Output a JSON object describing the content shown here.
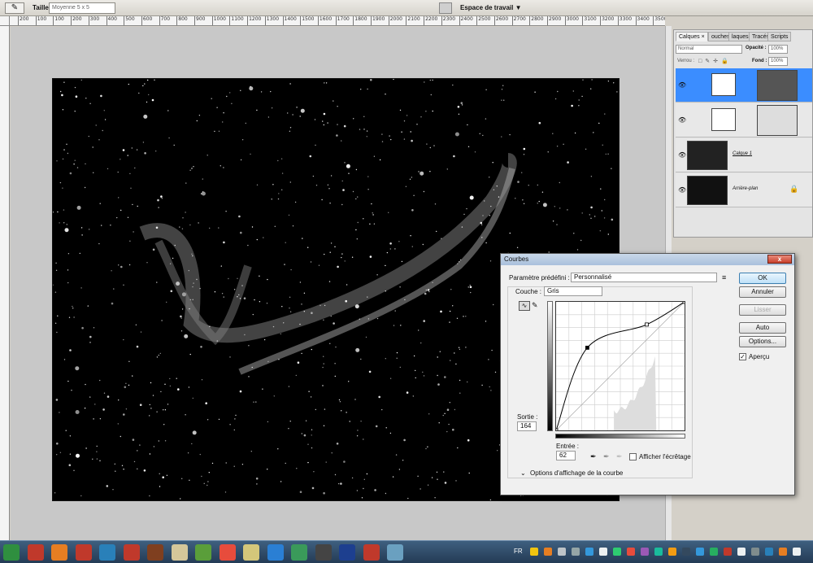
{
  "optbar": {
    "tool_icon": "eyedropper-icon",
    "size_label": "Taille :",
    "size_value": "Moyenne 5 x 5",
    "workspace_label": "Espace de travail ▼"
  },
  "ruler": [
    "200",
    "100",
    "100",
    "200",
    "300",
    "400",
    "500",
    "600",
    "700",
    "800",
    "900",
    "1000",
    "1100",
    "1200",
    "1300",
    "1400",
    "1500",
    "1600",
    "1700",
    "1800",
    "1900",
    "2000",
    "2100",
    "2200",
    "2300",
    "2400",
    "2500",
    "2600",
    "2700",
    "2800",
    "2900",
    "3000",
    "3100",
    "3200",
    "3300",
    "3400",
    "3500"
  ],
  "layers": {
    "tabs": [
      "Calques ×",
      "ouches",
      "laques",
      "Tracés",
      "Scripts"
    ],
    "blend_mode": "Normal",
    "opacity_label": "Opacité :",
    "opacity_value": "100%",
    "lock_label": "Verrou :",
    "fill_label": "Fond :",
    "fill_value": "100%",
    "items": [
      {
        "name": "",
        "type": "curves-adjustment",
        "selected": true
      },
      {
        "name": "",
        "type": "levels-adjustment",
        "selected": false
      },
      {
        "name": "Calque 1",
        "type": "image",
        "selected": false
      },
      {
        "name": "Arrière-plan",
        "type": "image",
        "selected": false
      }
    ]
  },
  "curves": {
    "title": "Courbes",
    "close": "x",
    "preset_label": "Paramètre prédéfini :",
    "preset_value": "Personnalisé",
    "channel_label": "Couche :",
    "channel_value": "Gris",
    "output_label": "Sortie :",
    "output_value": "164",
    "input_label": "Entrée :",
    "input_value": "62",
    "clip_label": "Afficher l'écrêtage",
    "options_label": "Options d'affichage de la courbe",
    "buttons": {
      "ok": "OK",
      "cancel": "Annuler",
      "smooth": "Lisser",
      "auto": "Auto",
      "options": "Options..."
    },
    "preview_label": "Aperçu",
    "preview_checked": true,
    "curve_points": [
      [
        0,
        0
      ],
      [
        62,
        164
      ],
      [
        180,
        210
      ],
      [
        255,
        255
      ]
    ]
  },
  "taskbar": {
    "language": "FR",
    "icons": [
      "windows-orb-icon",
      "app-icon",
      "firefox-icon",
      "filezilla-icon",
      "app-icon",
      "app-icon",
      "app-icon",
      "explorer-icon",
      "app-icon",
      "chrome-icon",
      "folder-icon",
      "skype-icon",
      "app-icon",
      "app-icon",
      "photoshop-icon",
      "app-icon",
      "app-icon"
    ]
  }
}
